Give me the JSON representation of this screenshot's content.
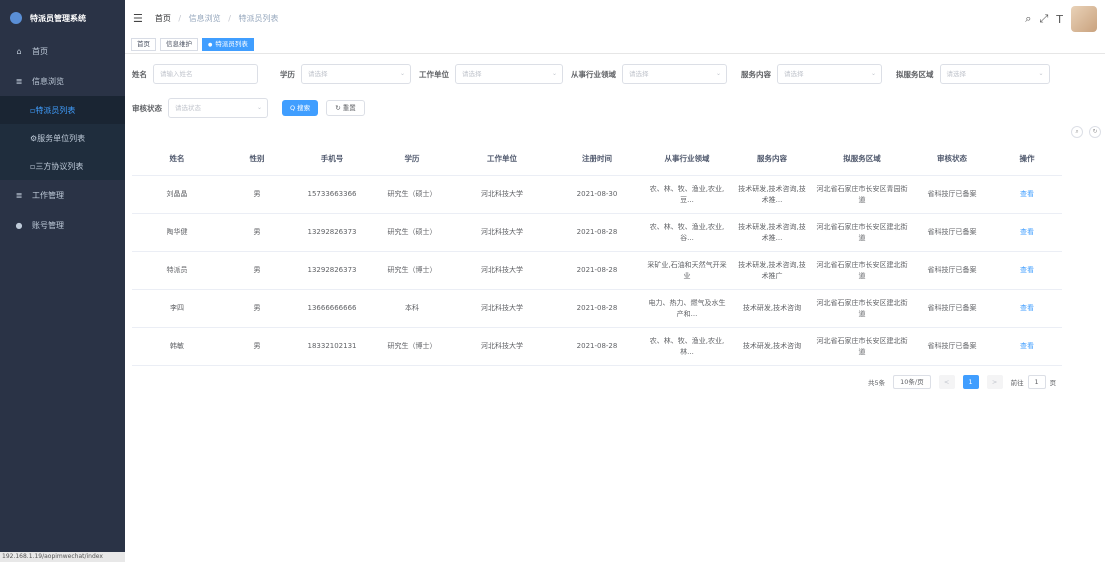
{
  "app": {
    "title": "特派员管理系统"
  },
  "sidebar": {
    "items": [
      {
        "label": "首页",
        "icon": "home-icon"
      },
      {
        "label": "信息浏览",
        "icon": "list-icon"
      },
      {
        "label": "特派员列表",
        "active": true
      },
      {
        "label": "服务单位列表"
      },
      {
        "label": "三方协议列表"
      },
      {
        "label": "工作管理",
        "icon": "work-icon"
      },
      {
        "label": "账号管理",
        "icon": "user-icon"
      }
    ],
    "status_url": "192.168.1.19/aopimwechat/index"
  },
  "header": {
    "breadcrumb": [
      "首页",
      "信息浏览",
      "特派员列表"
    ]
  },
  "tags": [
    "首页",
    "信息维护",
    "特派员列表"
  ],
  "filters": {
    "name_label": "姓名",
    "name_placeholder": "请输入姓名",
    "edu_label": "学历",
    "edu_placeholder": "请选择",
    "unit_label": "工作单位",
    "unit_placeholder": "请选择",
    "industry_label": "从事行业领域",
    "industry_placeholder": "请选择",
    "service_label": "服务内容",
    "service_placeholder": "请选择",
    "area_label": "拟服务区域",
    "area_placeholder": "请选择",
    "status_label": "审核状态",
    "status_placeholder": "请选状态",
    "search_label": "Q 搜索",
    "reset_label": "↻ 重置"
  },
  "table": {
    "headers": [
      "姓名",
      "性别",
      "手机号",
      "学历",
      "工作单位",
      "注册时间",
      "从事行业领域",
      "服务内容",
      "拟服务区域",
      "审核状态",
      "操作"
    ],
    "rows": [
      [
        "刘晶晶",
        "男",
        "15733663366",
        "研究生（硕士）",
        "河北科技大学",
        "2021-08-30",
        "农、林、牧、渔业,农业,豆...",
        "技术研发,技术咨询,技术推...",
        "河北省石家庄市长安区青园街道",
        "省科技厅已备案",
        "查看"
      ],
      [
        "陶华健",
        "男",
        "13292826373",
        "研究生（硕士）",
        "河北科技大学",
        "2021-08-28",
        "农、林、牧、渔业,农业,谷...",
        "技术研发,技术咨询,技术推...",
        "河北省石家庄市长安区建北街道",
        "省科技厅已备案",
        "查看"
      ],
      [
        "特派员",
        "男",
        "13292826373",
        "研究生（博士）",
        "河北科技大学",
        "2021-08-28",
        "采矿业,石油和天然气开采业",
        "技术研发,技术咨询,技术推广",
        "河北省石家庄市长安区建北街道",
        "省科技厅已备案",
        "查看"
      ],
      [
        "李四",
        "男",
        "13666666666",
        "本科",
        "河北科技大学",
        "2021-08-28",
        "电力、热力、燃气及水生产和...",
        "技术研发,技术咨询",
        "河北省石家庄市长安区建北街道",
        "省科技厅已备案",
        "查看"
      ],
      [
        "韩敏",
        "男",
        "18332102131",
        "研究生（博士）",
        "河北科技大学",
        "2021-08-28",
        "农、林、牧、渔业,农业,林...",
        "技术研发,技术咨询",
        "河北省石家庄市长安区建北街道",
        "省科技厅已备案",
        "查看"
      ]
    ]
  },
  "pagination": {
    "total": "共5条",
    "page_size": "10条/页",
    "prev": "<",
    "current": "1",
    "next": ">",
    "goto_label": "前往",
    "goto_value": "1",
    "page_suffix": "页"
  },
  "colors": {
    "sidebar": "#2a3346",
    "primary": "#409eff"
  }
}
